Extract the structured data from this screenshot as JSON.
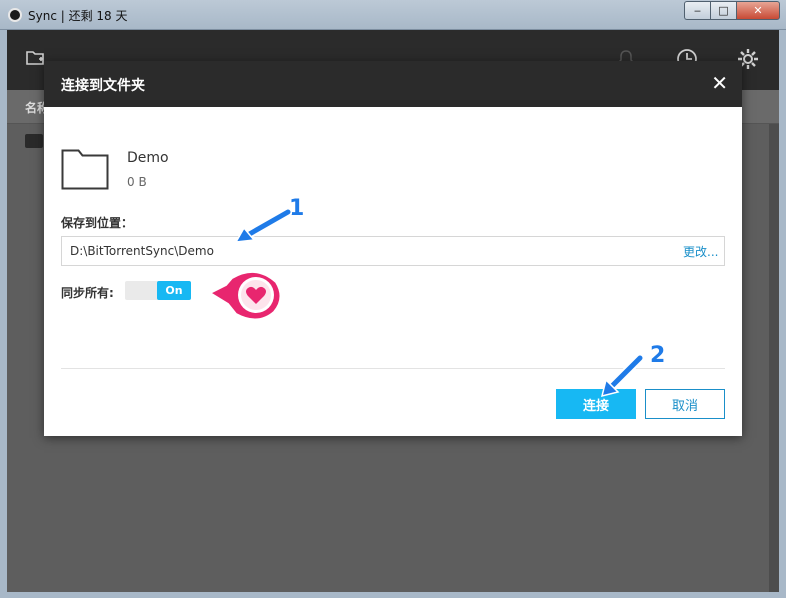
{
  "window": {
    "title": "Sync | 还剩 18 天",
    "minimize": "‒",
    "maximize": "□",
    "close": "✕"
  },
  "app": {
    "column_header": "名称"
  },
  "modal": {
    "title": "连接到文件夹",
    "close": "✕",
    "folder": {
      "name": "Demo",
      "size": "0 B"
    },
    "save_location_label": "保存到位置：",
    "save_path": "D:\\BitTorrentSync\\Demo",
    "change_link": "更改...",
    "sync_all_label": "同步所有:",
    "sync_all_toggle": "On",
    "connect_button": "连接",
    "cancel_button": "取消"
  },
  "annotations": {
    "step1": "1",
    "step2": "2"
  },
  "colors": {
    "accent": "#17b8f3",
    "link": "#1a8fc9",
    "annotation_blue": "#1f7be8",
    "annotation_pink": "#e8266f"
  }
}
